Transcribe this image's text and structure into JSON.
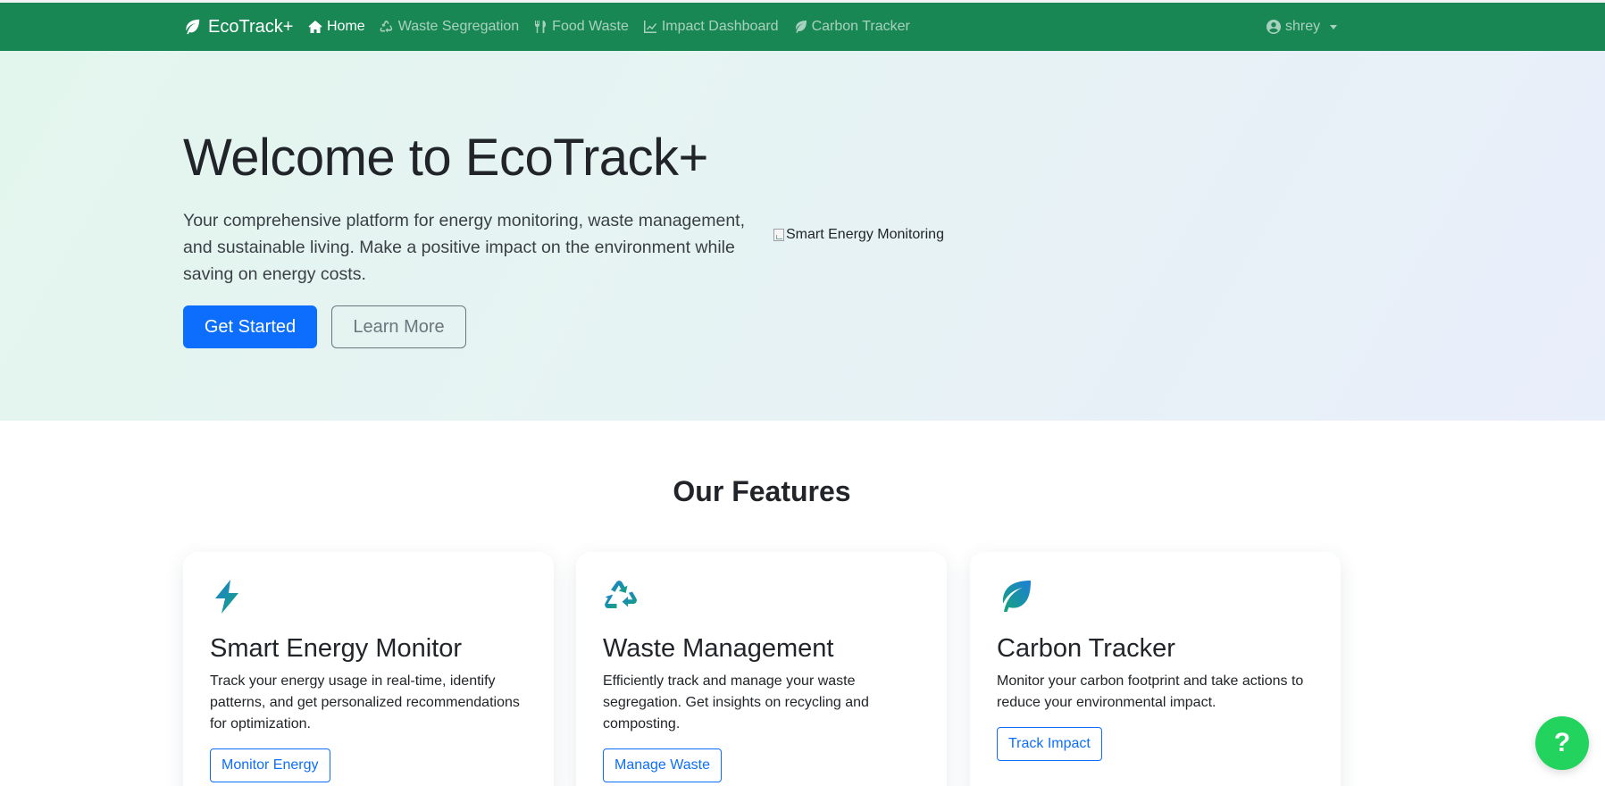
{
  "navbar": {
    "brand": "EcoTrack+",
    "links": [
      {
        "label": "Home",
        "icon": "home-icon",
        "active": true
      },
      {
        "label": "Waste Segregation",
        "icon": "recycle-icon"
      },
      {
        "label": "Food Waste",
        "icon": "utensils-icon"
      },
      {
        "label": "Impact Dashboard",
        "icon": "chart-line-icon"
      },
      {
        "label": "Carbon Tracker",
        "icon": "leaf-icon"
      }
    ],
    "user": "shrey",
    "colors": {
      "background": "#198754"
    }
  },
  "hero": {
    "title": "Welcome to EcoTrack+",
    "description": "Your comprehensive platform for energy monitoring, waste management, and sustainable living. Make a positive impact on the environment while saving on energy costs.",
    "primary_button": "Get Started",
    "secondary_button": "Learn More",
    "image_alt": "Smart Energy Monitoring"
  },
  "features": {
    "title": "Our Features",
    "cards": [
      {
        "icon": "bolt-icon",
        "title": "Smart Energy Monitor",
        "text": "Track your energy usage in real-time, identify patterns, and get personalized recommendations for optimization.",
        "button": "Monitor Energy"
      },
      {
        "icon": "recycle-icon",
        "title": "Waste Management",
        "text": "Efficiently track and manage your waste segregation. Get insights on recycling and composting.",
        "button": "Manage Waste"
      },
      {
        "icon": "leaf-icon",
        "title": "Carbon Tracker",
        "text": "Monitor your carbon footprint and take actions to reduce your environmental impact.",
        "button": "Track Impact"
      }
    ]
  },
  "help_button": "?",
  "colors": {
    "primary": "#0d6efd",
    "success": "#198754",
    "help": "#22d35e"
  }
}
